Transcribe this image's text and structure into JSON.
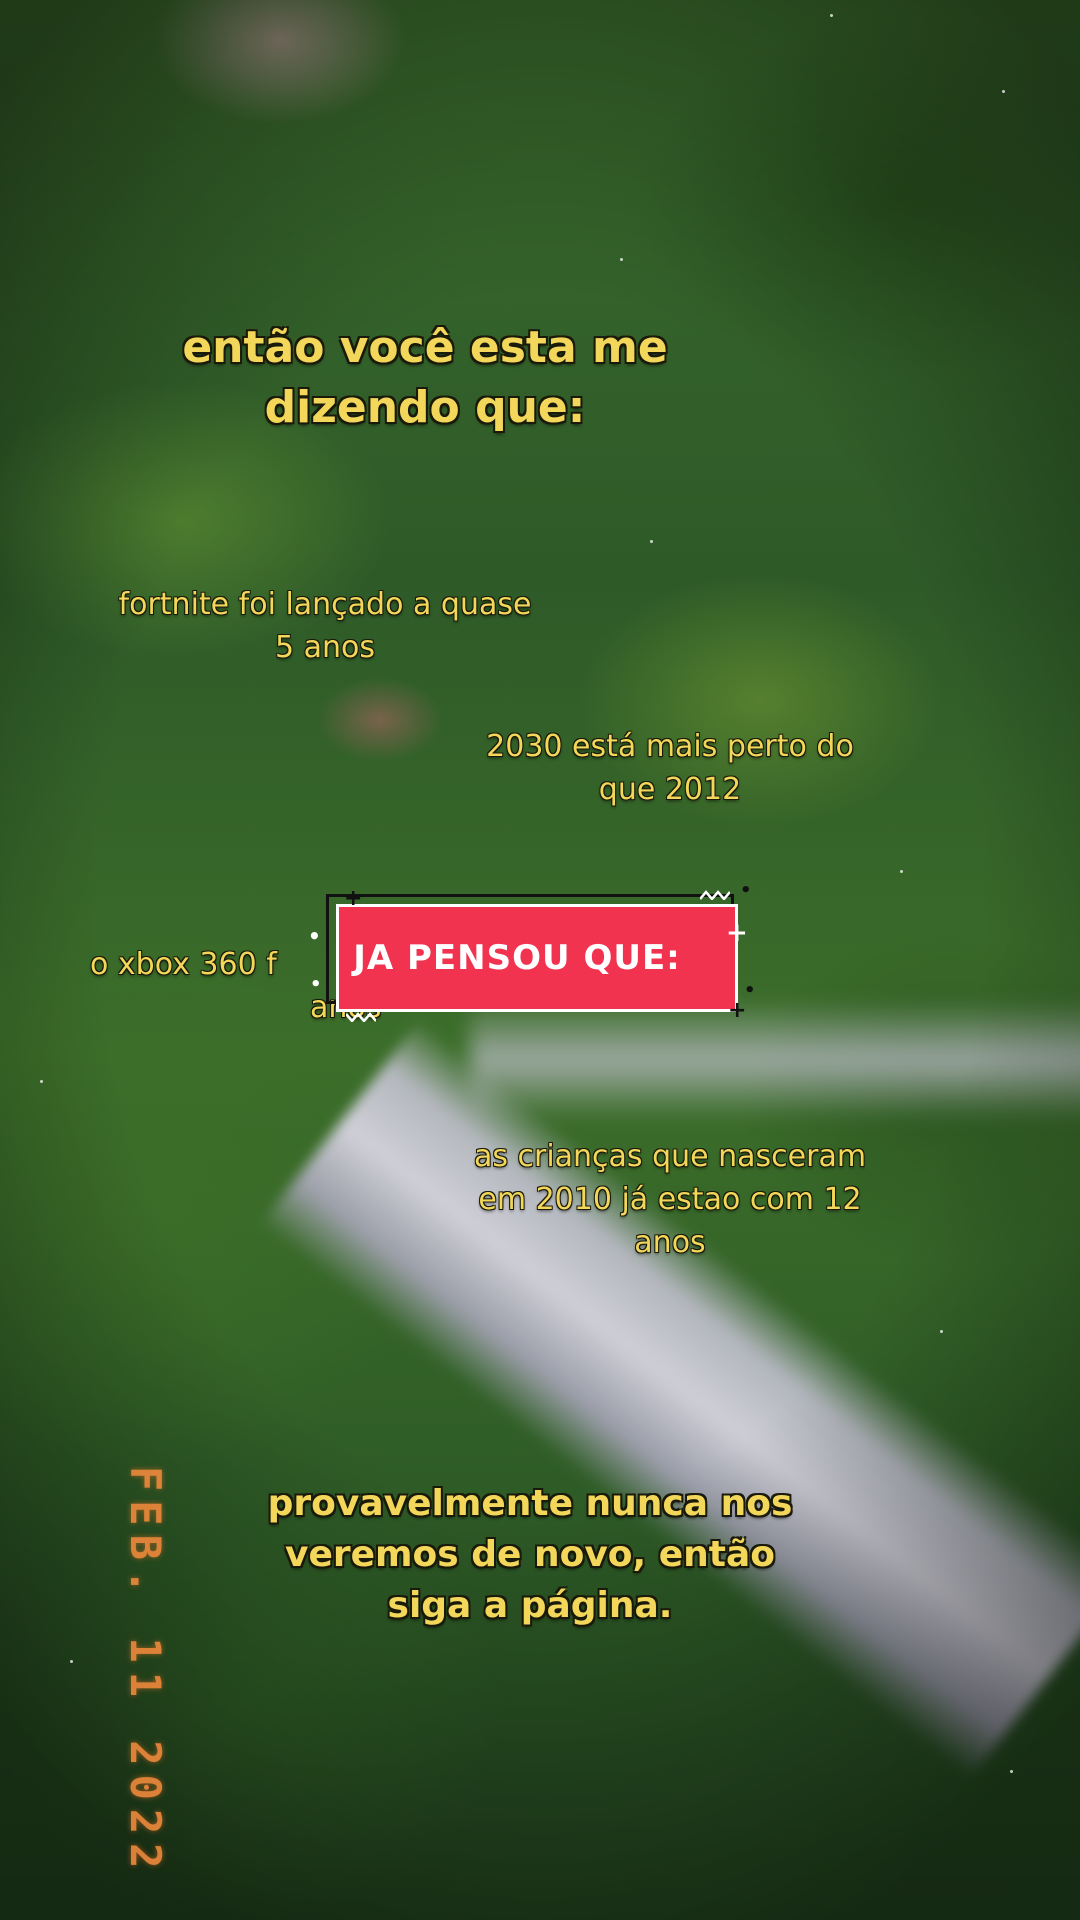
{
  "captions": {
    "title": [
      "então você esta me",
      "dizendo que:"
    ],
    "fortnite": [
      "fortnite foi lançado a quase",
      "5 anos"
    ],
    "year_2030": [
      "2030 está mais perto do",
      "que 2012"
    ],
    "xbox": [
      "o xbox 360 f",
      "anos"
    ],
    "children": [
      "as crianças que nasceram",
      "em 2010 já estao com 12",
      "anos"
    ],
    "ending": [
      "provavelmente nunca nos",
      "veremos de novo, então",
      "siga a página."
    ]
  },
  "banner": {
    "text": "JA PENSOU QUE:",
    "color": "#f2334f"
  },
  "datestamp": "FEB. 11 2022",
  "colors": {
    "caption_text": "#f2d75a",
    "datestamp": "#f08a3c"
  }
}
